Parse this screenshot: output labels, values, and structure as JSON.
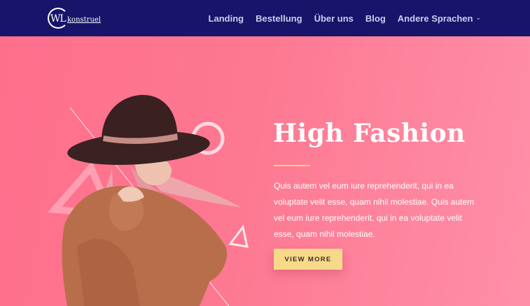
{
  "header": {
    "logo": {
      "initials": "WL",
      "wordmark": "konstruel"
    },
    "nav": [
      {
        "label": "Landing"
      },
      {
        "label": "Bestellung"
      },
      {
        "label": "Über uns"
      },
      {
        "label": "Blog"
      },
      {
        "label": "Andere Sprachen",
        "has_dropdown": true
      }
    ]
  },
  "hero": {
    "title": "High Fashion",
    "body": "Quis autem vel eum iure reprehenderit, qui in ea voluptate velit esse, quam nihil molestiae. Quis autem vel eum iure reprehenderit, qui in ea voluptate velit esse, quam nihil molestiae.",
    "cta_label": "VIEW MORE",
    "image": "woman-in-black-hat-photo"
  },
  "colors": {
    "header_bg": "#17146a",
    "hero_gradient_start": "#fe6f8c",
    "hero_gradient_end": "#ff8fa8",
    "accent": "#f8d98a",
    "nav_text": "#c9cdec"
  }
}
